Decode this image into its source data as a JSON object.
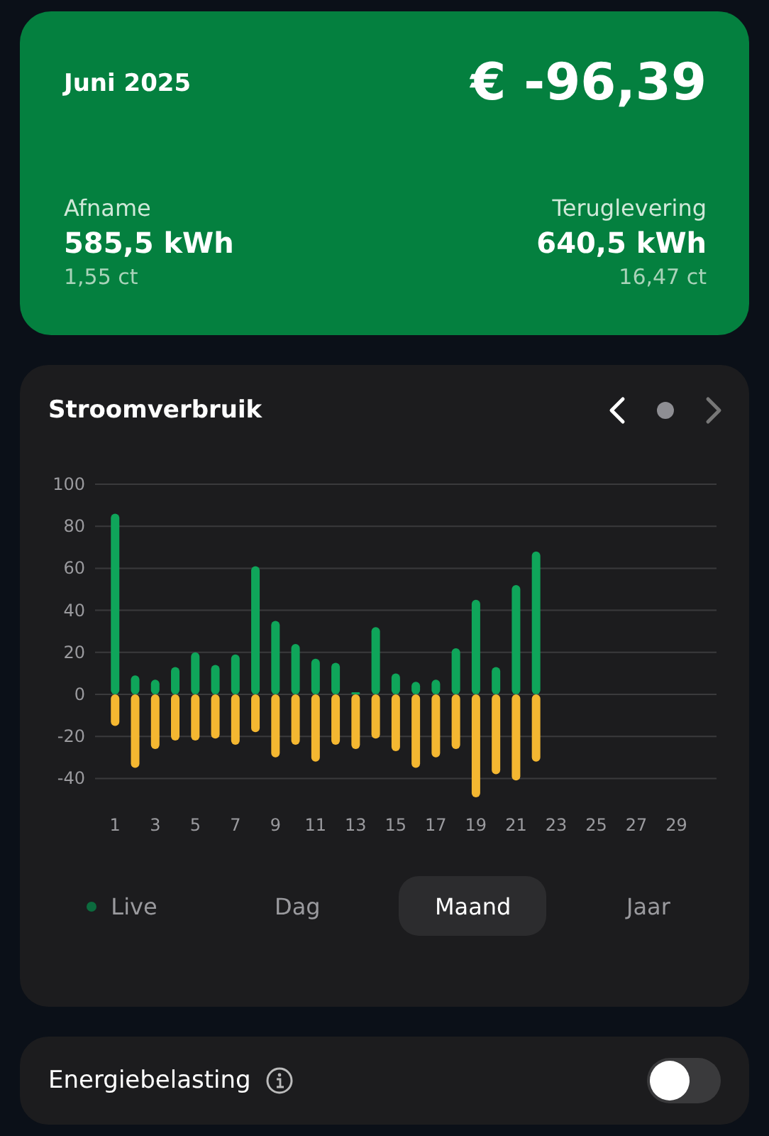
{
  "summary": {
    "period": "Juni 2025",
    "total": "€ -96,39",
    "left": {
      "label": "Afname",
      "amount": "585,5 kWh",
      "price": "1,55 ct"
    },
    "right": {
      "label": "Teruglevering",
      "amount": "640,5 kWh",
      "price": "16,47 ct"
    }
  },
  "usage": {
    "title": "Stroomverbruik",
    "pager": {
      "previous_enabled": true,
      "next_enabled": false
    },
    "chart_data": {
      "type": "bar",
      "stacked": true,
      "grid": true,
      "x": [
        1,
        2,
        3,
        4,
        5,
        6,
        7,
        8,
        9,
        10,
        11,
        12,
        13,
        14,
        15,
        16,
        17,
        18,
        19,
        20,
        21,
        22
      ],
      "series": [
        {
          "color": "#0fa55a",
          "values": [
            86,
            9,
            7,
            13,
            20,
            14,
            19,
            61,
            35,
            24,
            17,
            15,
            1,
            32,
            10,
            6,
            7,
            22,
            45,
            13,
            52,
            68
          ]
        },
        {
          "color": "#f4b731",
          "values": [
            -15,
            -35,
            -26,
            -22,
            -22,
            -21,
            -24,
            -18,
            -30,
            -24,
            -32,
            -24,
            -26,
            -21,
            -27,
            -35,
            -30,
            -26,
            -49,
            -38,
            -41,
            -32
          ]
        }
      ],
      "xlim": [
        0,
        31
      ],
      "ylim": [
        -50,
        100
      ],
      "yticks": [
        -40,
        -20,
        0,
        20,
        40,
        60,
        80,
        100
      ],
      "xticks": [
        1,
        3,
        5,
        7,
        9,
        11,
        13,
        15,
        17,
        19,
        21,
        23,
        25,
        27,
        29
      ]
    },
    "ranges": [
      {
        "label": "Live",
        "kind": "live",
        "selected": false
      },
      {
        "label": "Dag",
        "kind": "plain",
        "selected": false
      },
      {
        "label": "Maand",
        "kind": "plain",
        "selected": true
      },
      {
        "label": "Jaar",
        "kind": "plain",
        "selected": false
      }
    ]
  },
  "tax": {
    "label": "Energiebelasting",
    "on": false
  }
}
